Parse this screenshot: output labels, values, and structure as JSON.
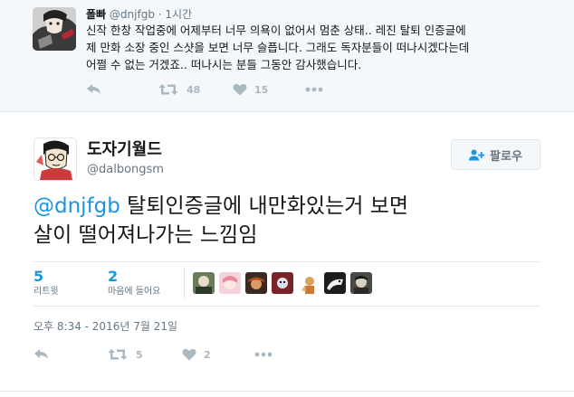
{
  "parent_tweet": {
    "name": "폴빠",
    "handle": "@dnjfgb",
    "separator": "·",
    "time": "1시간",
    "text_lines": [
      "신작 한창 작업중에 어제부터 너무 의욕이 없어서 멈춘 상태.. 레진 탈퇴 인증글에",
      "제 만화 소장 중인 스샷을 보면 너무 슬픕니다. 그래도 독자분들이 떠나시겠다는데",
      "어쩔 수 없는 거겠죠.. 떠나시는 분들 그동안 감사했습니다."
    ],
    "retweet_count": "48",
    "like_count": "15"
  },
  "main_tweet": {
    "name": "도자기월드",
    "handle": "@dalbongsm",
    "follow_label": "팔로우",
    "mention": "@dnjfgb",
    "text_line1_rest": " 탈퇴인증글에 내만화있는거 보면",
    "text_line2": "살이 떨어져나가는 느낌임",
    "retweets_value": "5",
    "retweets_label": "리트윗",
    "likes_value": "2",
    "likes_label": "마음에 들어요",
    "timestamp": "오후 8:34 - 2016년 7월 21일",
    "retweet_count": "5",
    "like_count": "2"
  },
  "colors": {
    "accent": "#1b95e0",
    "muted_text": "#657786",
    "icon_gray": "#aab8c2",
    "parent_bg": "#f5f8fa",
    "border": "#e1e8ed"
  },
  "icons": [
    "reply-icon",
    "retweet-icon",
    "heart-icon",
    "more-icon",
    "follow-user-icon"
  ]
}
